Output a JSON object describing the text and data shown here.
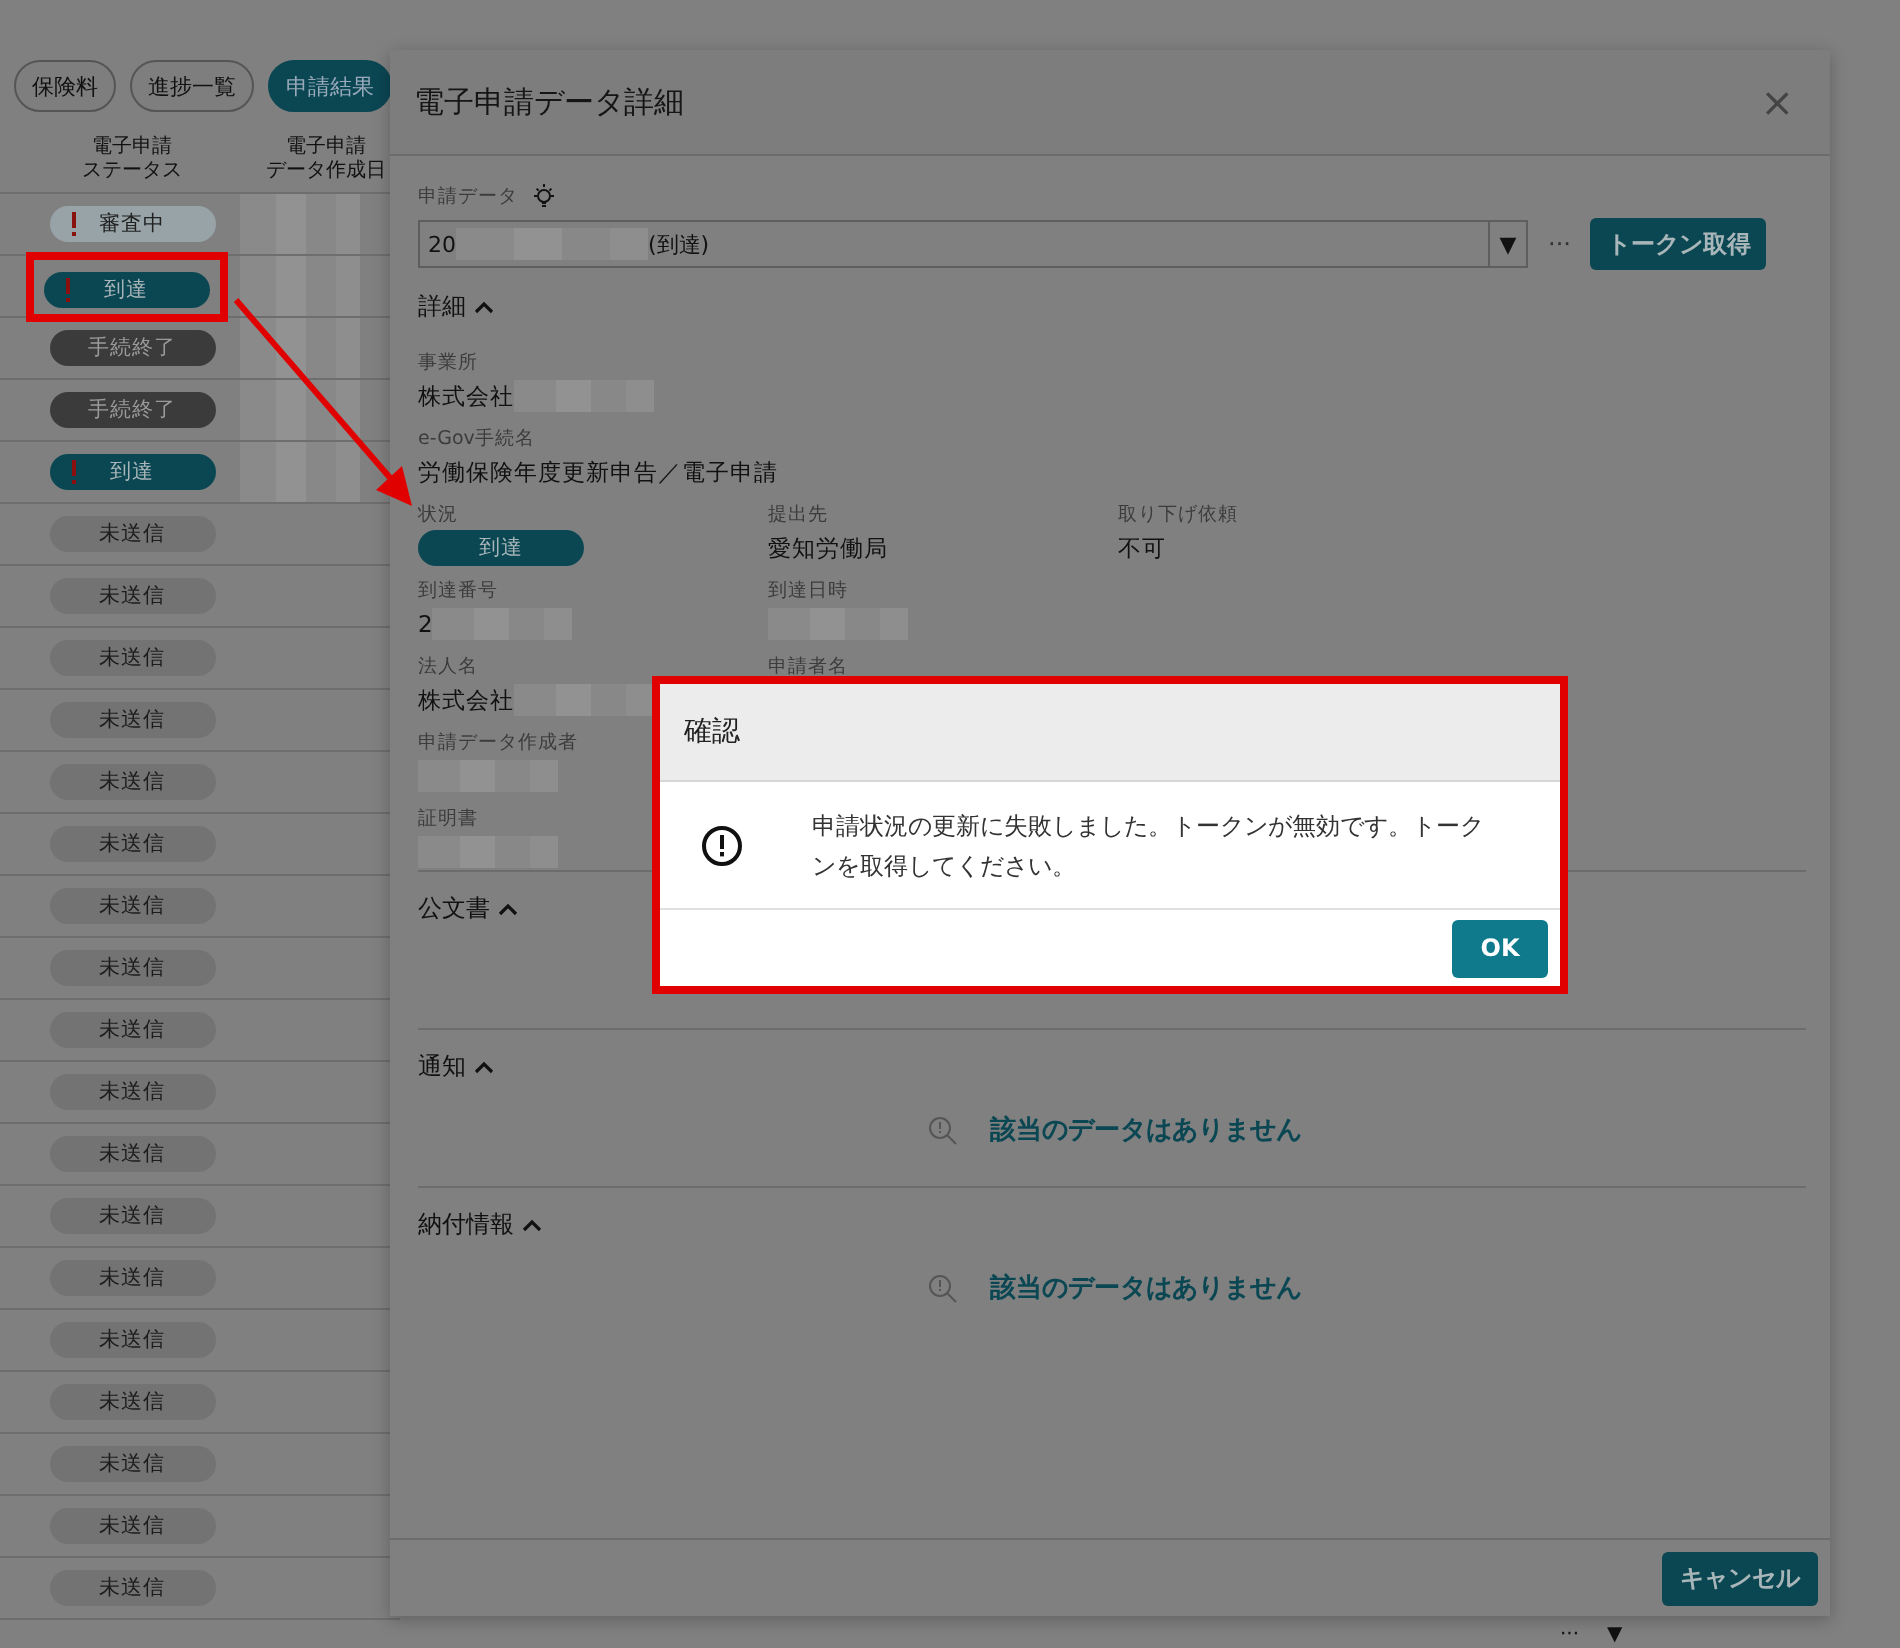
{
  "tabs": [
    {
      "label": "保険料",
      "selected": false
    },
    {
      "label": "進捗一覧",
      "selected": false
    },
    {
      "label": "申請結果",
      "selected": true
    }
  ],
  "table": {
    "columns": [
      [
        "電子申請",
        "ステータス"
      ],
      [
        "電子申請",
        "データ作成日"
      ]
    ],
    "rows": [
      {
        "status": "審査中",
        "kind": "review",
        "alert": true,
        "redacted": true,
        "highlighted": false
      },
      {
        "status": "到達",
        "kind": "arrived",
        "alert": true,
        "redacted": true,
        "highlighted": true
      },
      {
        "status": "手続終了",
        "kind": "done",
        "alert": false,
        "redacted": true,
        "highlighted": false
      },
      {
        "status": "手続終了",
        "kind": "done",
        "alert": false,
        "redacted": true,
        "highlighted": false
      },
      {
        "status": "到達",
        "kind": "arrived",
        "alert": true,
        "redacted": true,
        "highlighted": false
      },
      {
        "status": "未送信",
        "kind": "unsent",
        "alert": false,
        "redacted": false,
        "highlighted": false
      },
      {
        "status": "未送信",
        "kind": "unsent",
        "alert": false,
        "redacted": false,
        "highlighted": false
      },
      {
        "status": "未送信",
        "kind": "unsent",
        "alert": false,
        "redacted": false,
        "highlighted": false
      },
      {
        "status": "未送信",
        "kind": "unsent",
        "alert": false,
        "redacted": false,
        "highlighted": false
      },
      {
        "status": "未送信",
        "kind": "unsent",
        "alert": false,
        "redacted": false,
        "highlighted": false
      },
      {
        "status": "未送信",
        "kind": "unsent",
        "alert": false,
        "redacted": false,
        "highlighted": false
      },
      {
        "status": "未送信",
        "kind": "unsent",
        "alert": false,
        "redacted": false,
        "highlighted": false
      },
      {
        "status": "未送信",
        "kind": "unsent",
        "alert": false,
        "redacted": false,
        "highlighted": false
      },
      {
        "status": "未送信",
        "kind": "unsent",
        "alert": false,
        "redacted": false,
        "highlighted": false
      },
      {
        "status": "未送信",
        "kind": "unsent",
        "alert": false,
        "redacted": false,
        "highlighted": false
      },
      {
        "status": "未送信",
        "kind": "unsent",
        "alert": false,
        "redacted": false,
        "highlighted": false
      },
      {
        "status": "未送信",
        "kind": "unsent",
        "alert": false,
        "redacted": false,
        "highlighted": false
      },
      {
        "status": "未送信",
        "kind": "unsent",
        "alert": false,
        "redacted": false,
        "highlighted": false
      },
      {
        "status": "未送信",
        "kind": "unsent",
        "alert": false,
        "redacted": false,
        "highlighted": false
      },
      {
        "status": "未送信",
        "kind": "unsent",
        "alert": false,
        "redacted": false,
        "highlighted": false
      },
      {
        "status": "未送信",
        "kind": "unsent",
        "alert": false,
        "redacted": false,
        "highlighted": false
      },
      {
        "status": "未送信",
        "kind": "unsent",
        "alert": false,
        "redacted": false,
        "highlighted": false
      },
      {
        "status": "未送信",
        "kind": "unsent",
        "alert": false,
        "redacted": false,
        "highlighted": false
      }
    ]
  },
  "corner_controls": [
    "···",
    "▼"
  ],
  "detail": {
    "title": "電子申請データ詳細",
    "close": "×",
    "data_field": {
      "label": "申請データ",
      "value_start": "20",
      "value_end": "(到達)",
      "dropdown": "▼"
    },
    "more": "···",
    "token_button": "トークン取得",
    "sections": [
      {
        "title": "詳細",
        "expanded": true,
        "kind": "fields",
        "rows": [
          [
            {
              "label": "事業所",
              "value": "株式会社",
              "redacted": true
            }
          ],
          [
            {
              "label": "e-Gov手続名",
              "value": "労働保険年度更新申告／電子申請",
              "redacted": false
            }
          ],
          [
            {
              "label": "状況",
              "badge": "到達",
              "kind": "arrived"
            },
            {
              "label": "提出先",
              "value": "愛知労働局",
              "redacted": false
            },
            {
              "label": "取り下げ依頼",
              "value": "不可",
              "redacted": false
            }
          ],
          [
            {
              "label": "到達番号",
              "value": "2",
              "redacted": true
            },
            {
              "label": "到達日時",
              "redacted": true
            }
          ],
          [
            {
              "label": "法人名",
              "value": "株式会社",
              "redacted": true
            },
            {
              "label": "申請者名",
              "redacted": false
            }
          ],
          [
            {
              "label": "申請データ作成者",
              "redacted": true
            }
          ],
          [
            {
              "label": "証明書",
              "redacted": true
            }
          ]
        ]
      },
      {
        "title": "公文書",
        "expanded": true,
        "kind": "covered"
      },
      {
        "title": "通知",
        "expanded": true,
        "kind": "empty",
        "empty_text": "該当のデータはありません"
      },
      {
        "title": "納付情報",
        "expanded": true,
        "kind": "empty",
        "empty_text": "該当のデータはありません"
      }
    ],
    "cancel_button": "キャンセル"
  },
  "confirm_dialog": {
    "title": "確認",
    "message": "申請状況の更新に失敗しました。トークンが無効です。トークンを取得してください。",
    "ok_button": "OK",
    "highlighted": true
  }
}
